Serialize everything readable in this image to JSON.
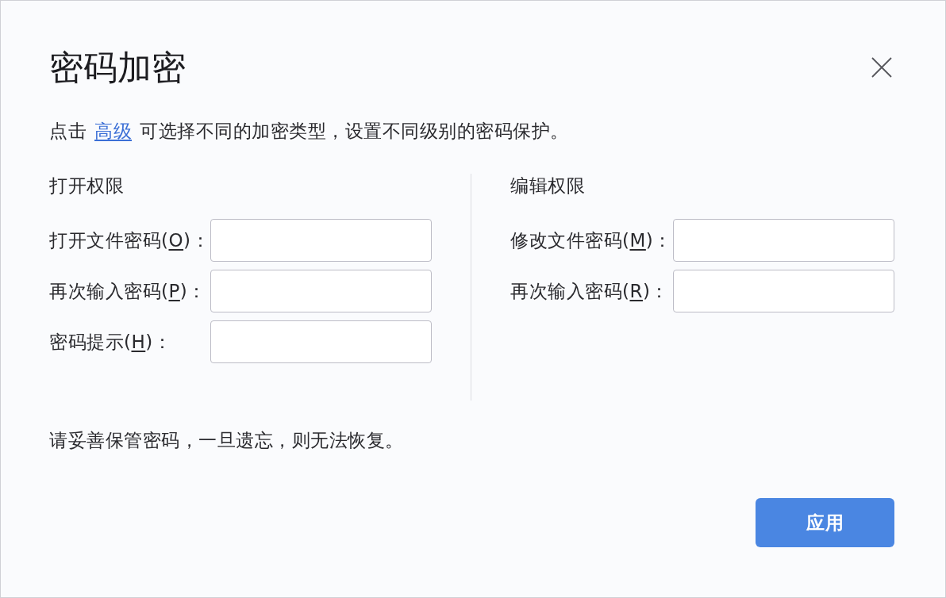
{
  "dialog": {
    "title": "密码加密",
    "description": {
      "lead": "点击",
      "link": "高级",
      "rest": "可选择不同的加密类型，设置不同级别的密码保护。"
    },
    "sections": [
      {
        "heading": "打开权限",
        "fields": [
          {
            "label": "打开文件密码(",
            "access_key": "O",
            "label_end": ")："
          },
          {
            "label": "再次输入密码(",
            "access_key": "P",
            "label_end": ")："
          },
          {
            "label": "密码提示(",
            "access_key": "H",
            "label_end": ")："
          }
        ]
      },
      {
        "heading": "编辑权限",
        "fields": [
          {
            "label": "修改文件密码(",
            "access_key": "M",
            "label_end": ")："
          },
          {
            "label": "再次输入密码(",
            "access_key": "R",
            "label_end": ")："
          }
        ]
      }
    ],
    "note": "请妥善保管密码，一旦遗忘，则无法恢复。",
    "buttons": [
      {
        "label": "应用",
        "kind": "primary"
      }
    ]
  }
}
